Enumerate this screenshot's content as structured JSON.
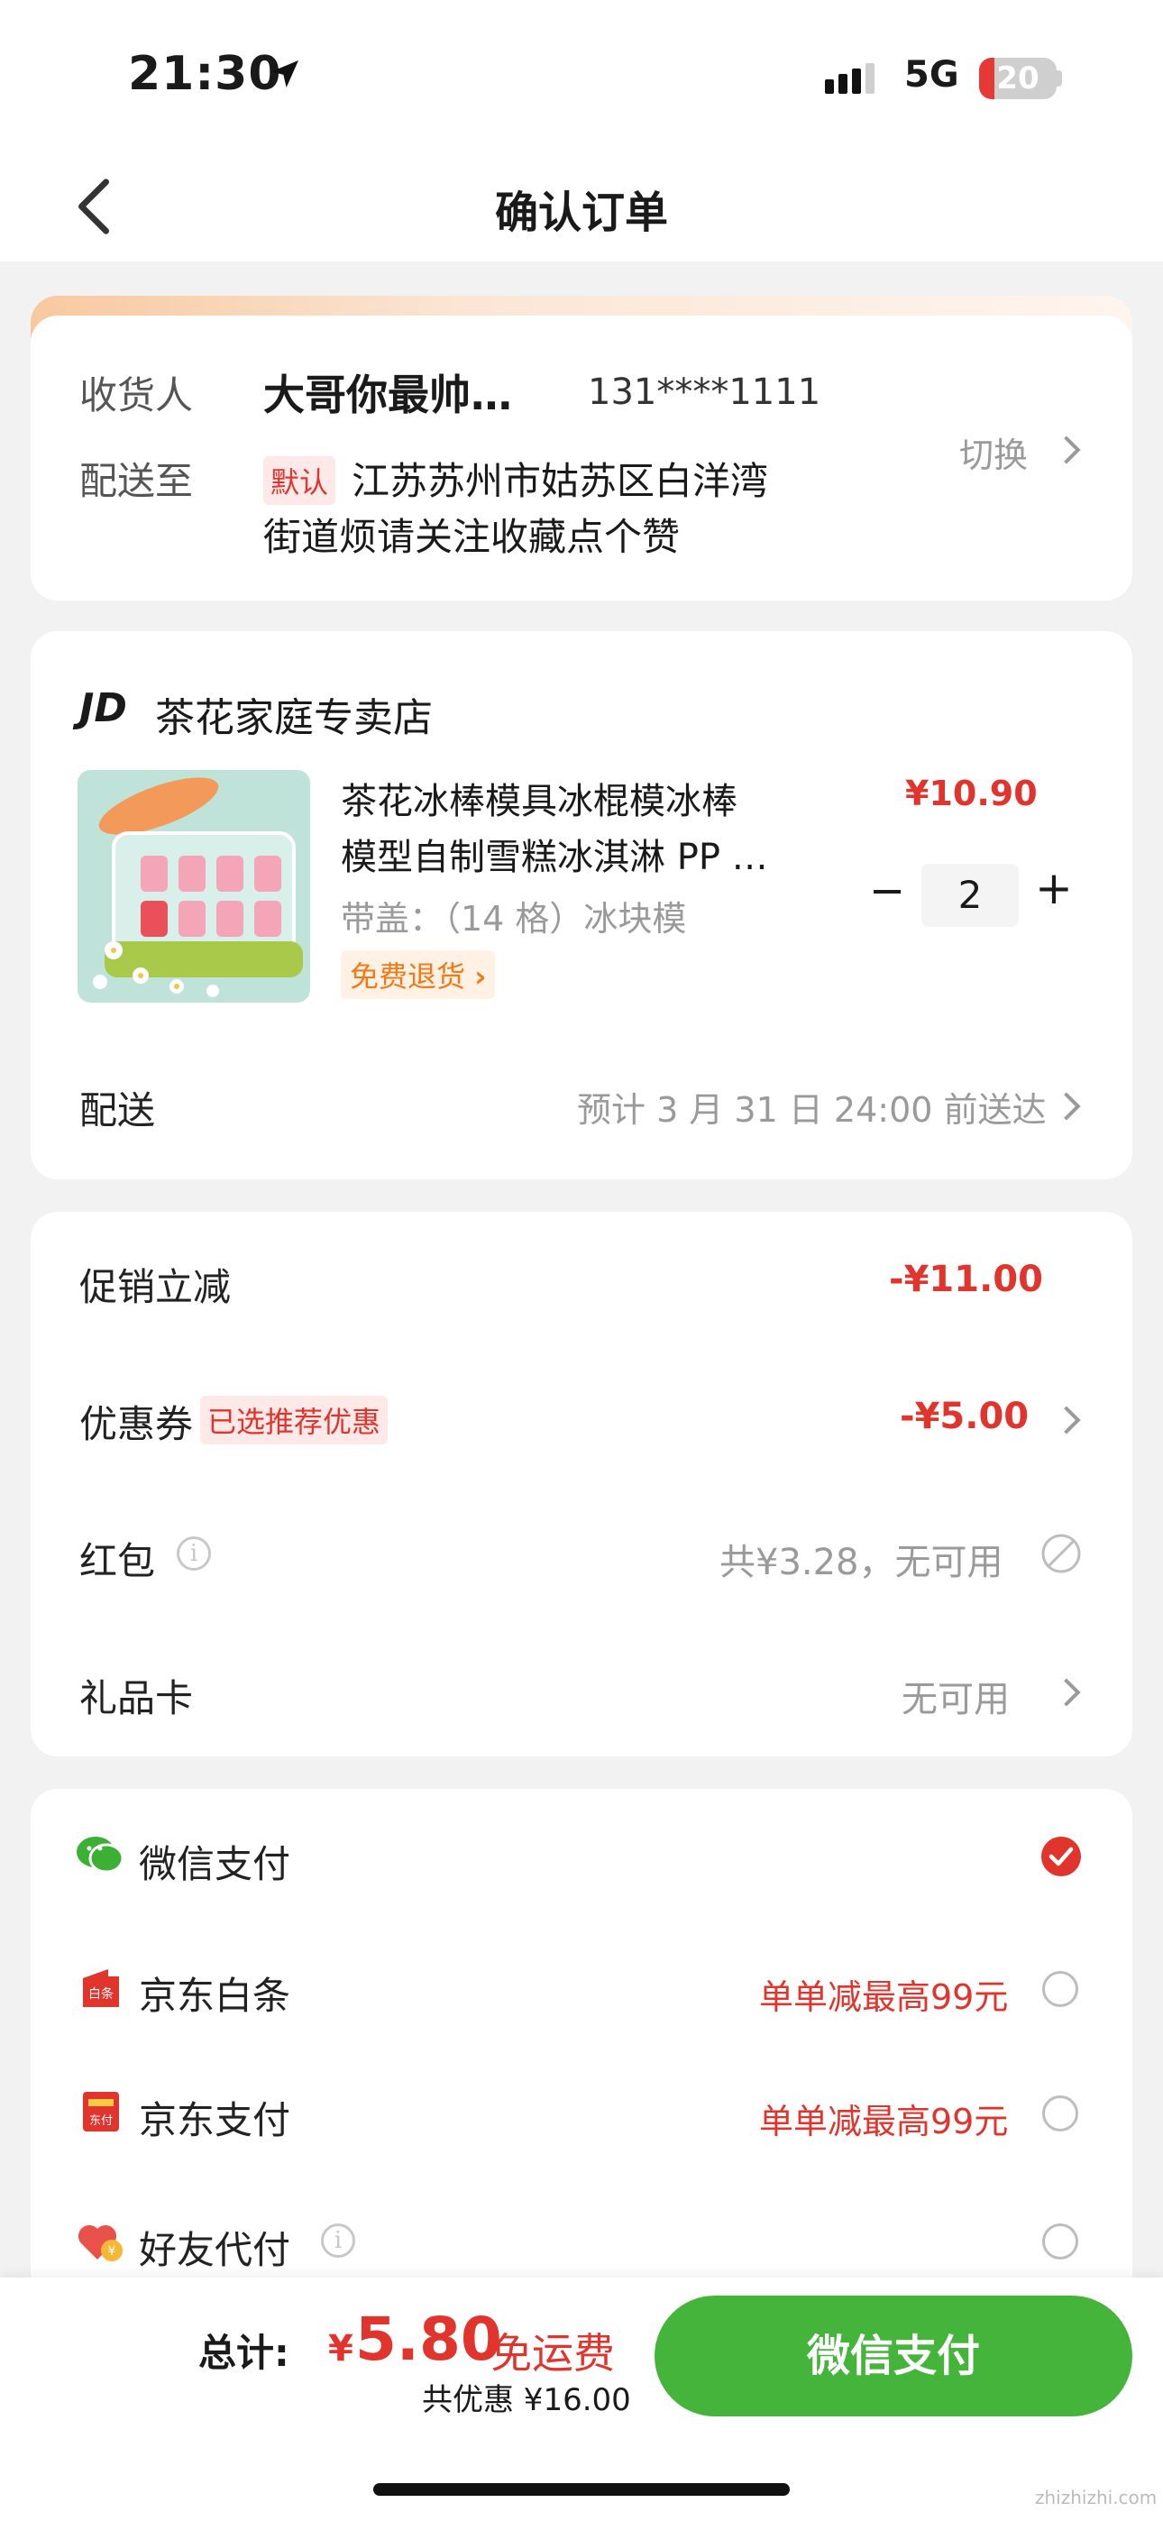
{
  "status": {
    "time": "21:30",
    "network": "5G",
    "battery": "20"
  },
  "nav": {
    "title": "确认订单"
  },
  "address": {
    "receiver_label": "收货人",
    "receiver_name": "大哥你最帅…",
    "phone": "131****1111",
    "ship_label": "配送至",
    "default_tag": "默认",
    "line1": "江苏苏州市姑苏区白洋湾",
    "line2": "街道烦请关注收藏点个赞",
    "switch_label": "切换"
  },
  "shop": {
    "logo": "JD",
    "name": "茶花家庭专卖店",
    "product": {
      "title_line1": "茶花冰棒模具冰棍模冰棒",
      "title_line2": "模型自制雪糕冰淇淋 PP …",
      "variant": "带盖：（14 格）冰块模",
      "return_tag": "免费退货",
      "price": "¥10.90",
      "quantity": "2",
      "minus": "−",
      "plus": "+"
    },
    "delivery_label": "配送",
    "delivery_value": "预计 3 月 31 日 24:00 前送达"
  },
  "discounts": {
    "promo_label": "促销立减",
    "promo_value": "-¥11.00",
    "coupon_label": "优惠券",
    "coupon_tag": "已选推荐优惠",
    "coupon_value": "-¥5.00",
    "redpacket_label": "红包",
    "redpacket_value": "共¥3.28，无可用",
    "giftcard_label": "礼品卡",
    "giftcard_value": "无可用"
  },
  "payment": {
    "methods": [
      {
        "label": "微信支付",
        "promo": "",
        "selected": true
      },
      {
        "label": "京东白条",
        "promo": "单单减最高99元",
        "selected": false
      },
      {
        "label": "京东支付",
        "promo": "单单减最高99元",
        "selected": false
      },
      {
        "label": "好友代付",
        "promo": "",
        "selected": false
      }
    ]
  },
  "footer": {
    "total_label": "总计:",
    "currency": "¥",
    "total": "5.80",
    "shipping": "免运费",
    "saved": "共优惠 ¥16.00",
    "pay_button": "微信支付"
  },
  "watermark": "zhizhizhi.com",
  "colors": {
    "accent_red": "#e0342c",
    "wechat_green": "#3cb034",
    "pay_button": "#44b53a"
  }
}
